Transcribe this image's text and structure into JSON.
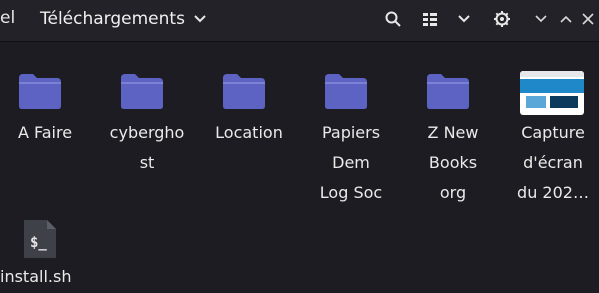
{
  "header": {
    "prev_crumb": "el",
    "current_folder": "Téléchargements"
  },
  "files": [
    {
      "name": "A Faire",
      "type": "folder"
    },
    {
      "name": "cyberghost",
      "display": "cybergho\nst",
      "type": "folder"
    },
    {
      "name": "Location",
      "type": "folder"
    },
    {
      "name": "Papiers Dem Log Soc",
      "display": "Papiers\nDem\nLog Soc",
      "type": "folder"
    },
    {
      "name": "Z New Books org",
      "display": "Z New\nBooks\norg",
      "type": "folder"
    },
    {
      "name": "Capture d'écran du 202…",
      "display": "Capture\nd'écran\ndu 202…",
      "type": "image"
    },
    {
      "name": "install.sh",
      "type": "script",
      "icon_text": "$_"
    }
  ],
  "colors": {
    "background": "#1c1c22",
    "header": "#222228",
    "folder": "#5c63c2",
    "text": "#eaeaea"
  }
}
